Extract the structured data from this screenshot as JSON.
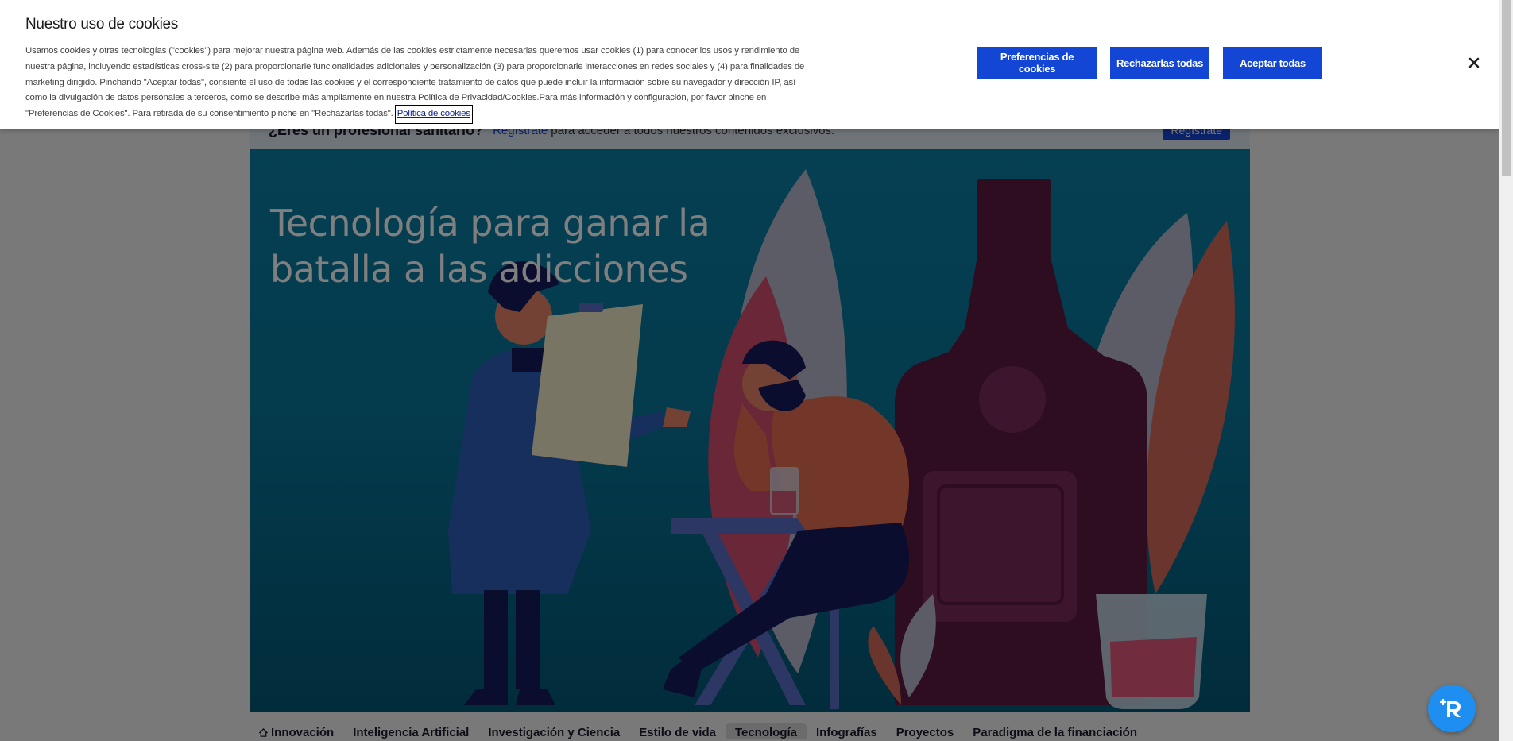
{
  "page": {
    "pro_banner": {
      "title": "¿Eres un profesional sanitario?",
      "link": "Regístrate",
      "text": "para acceder a todos nuestros contenidos exclusivos.",
      "button": "Regístrate"
    },
    "hero": {
      "title": "Tecnología para ganar la batalla a las adicciones"
    },
    "nav": {
      "items": [
        {
          "label": "Innovación",
          "icon": "home-icon"
        },
        {
          "label": "Inteligencia Artificial"
        },
        {
          "label": "Investigación y Ciencia"
        },
        {
          "label": "Estilo de vida"
        },
        {
          "label": "Tecnología",
          "active": true
        },
        {
          "label": "Infografías"
        },
        {
          "label": "Proyectos"
        },
        {
          "label": "Paradigma de la financiación"
        }
      ]
    }
  },
  "cookie": {
    "title": "Nuestro uso de cookies",
    "body": "Usamos cookies y otras tecnologías (\"cookies\") para mejorar nuestra página web. Además de las cookies estrictamente necesarias queremos usar cookies (1) para conocer los usos y rendimiento de nuestra página, incluyendo estadísticas cross-site (2) para proporcionarle funcionalidades adicionales y personalización (3) para proporcionarle interacciones en redes sociales y (4) para finalidades de marketing dirigido. Pinchando \"Aceptar todas\", consiente el uso de todas las cookies y el correspondiente tratamiento de datos que puede incluir la información sobre su navegador y dirección IP, así como la divulgación de datos personales a terceros, como se describe más ampliamente en nuestra Política de Privacidad/Cookies.Para más información y configuración, por favor pinche en \"Preferencias de Cookies\". Para retirada de su consentimiento pinche en \"Rechazarlas todas\".",
    "policy_link": "Política de cookies",
    "buttons": {
      "preferences": "Preferencias de cookies",
      "reject": "Rechazarlas todas",
      "accept": "Aceptar todas"
    },
    "close_icon": "close-icon"
  },
  "colors": {
    "accent": "#1446d6",
    "hero_bg": "#0b7fa4",
    "fab": "#1e8ff0"
  }
}
